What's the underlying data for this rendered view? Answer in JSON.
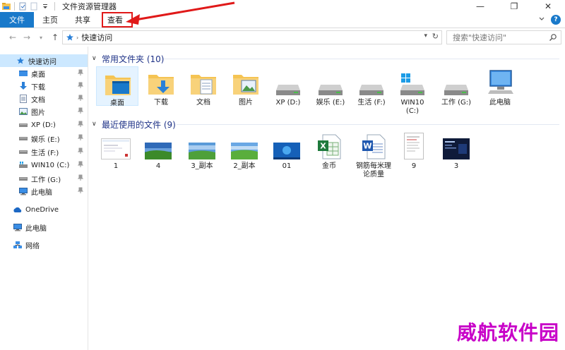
{
  "window": {
    "title": "文件资源管理器",
    "minimize": "—",
    "maximize": "❐",
    "close": "✕"
  },
  "ribbon": {
    "tabs": [
      "文件",
      "主页",
      "共享",
      "查看"
    ],
    "help": "?"
  },
  "address": {
    "path": "快速访问",
    "search_placeholder": "搜索\"快速访问\""
  },
  "sidebar": {
    "items": [
      {
        "label": "快速访问",
        "icon": "star-icon",
        "selected": true
      },
      {
        "label": "桌面",
        "icon": "desktop-icon",
        "pinned": true
      },
      {
        "label": "下载",
        "icon": "download-icon",
        "pinned": true
      },
      {
        "label": "文档",
        "icon": "document-icon",
        "pinned": true
      },
      {
        "label": "图片",
        "icon": "picture-icon",
        "pinned": true
      },
      {
        "label": "XP (D:)",
        "icon": "drive-icon",
        "pinned": true
      },
      {
        "label": "娱乐 (E:)",
        "icon": "drive-icon",
        "pinned": true
      },
      {
        "label": "生活 (F:)",
        "icon": "drive-icon",
        "pinned": true
      },
      {
        "label": "WIN10 (C:)",
        "icon": "windows-drive-icon",
        "pinned": true
      },
      {
        "label": "工作 (G:)",
        "icon": "drive-icon",
        "pinned": true
      },
      {
        "label": "此电脑",
        "icon": "computer-icon",
        "pinned": true
      },
      {
        "label": "OneDrive",
        "icon": "cloud-icon"
      },
      {
        "label": "此电脑",
        "icon": "computer-icon"
      },
      {
        "label": "网络",
        "icon": "network-icon"
      }
    ]
  },
  "frequent": {
    "header": "常用文件夹 (10)",
    "items": [
      {
        "label": "桌面",
        "icon": "desktop-folder-icon"
      },
      {
        "label": "下载",
        "icon": "download-folder-icon"
      },
      {
        "label": "文档",
        "icon": "document-folder-icon"
      },
      {
        "label": "图片",
        "icon": "picture-folder-icon"
      },
      {
        "label": "XP (D:)",
        "icon": "drive-icon"
      },
      {
        "label": "娱乐 (E:)",
        "icon": "drive-icon"
      },
      {
        "label": "生活 (F:)",
        "icon": "drive-icon"
      },
      {
        "label": "WIN10 (C:)",
        "icon": "windows-drive-icon"
      },
      {
        "label": "工作 (G:)",
        "icon": "drive-icon"
      },
      {
        "label": "此电脑",
        "icon": "computer-icon"
      }
    ]
  },
  "recent": {
    "header": "最近使用的文件 (9)",
    "items": [
      {
        "label": "1",
        "icon": "screenshot-thumbnail"
      },
      {
        "label": "4",
        "icon": "landscape-thumbnail"
      },
      {
        "label": "3_副本",
        "icon": "landscape-thumbnail"
      },
      {
        "label": "2_副本",
        "icon": "landscape-thumbnail"
      },
      {
        "label": "01",
        "icon": "windows7-thumbnail"
      },
      {
        "label": "金币",
        "icon": "excel-file-icon"
      },
      {
        "label": "钢筋每米理论质量",
        "icon": "word-file-icon"
      },
      {
        "label": "9",
        "icon": "document-thumbnail"
      },
      {
        "label": "3",
        "icon": "dark-screenshot-thumbnail"
      }
    ]
  },
  "watermark": "威航软件园",
  "colors": {
    "accent": "#1979ca",
    "highlight": "#e01919",
    "selected": "#cce8ff",
    "folder": "#f5c453",
    "watermark": "#c800c8"
  }
}
